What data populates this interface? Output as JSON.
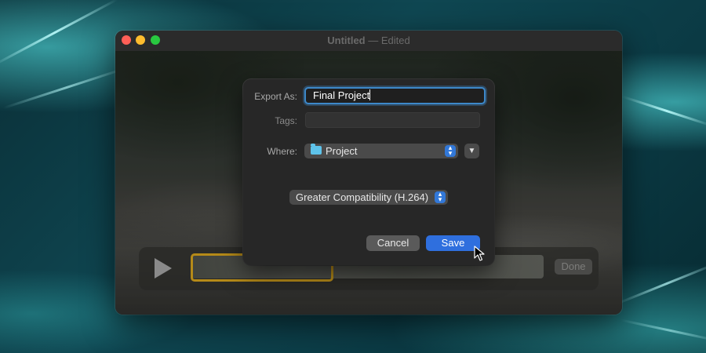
{
  "window": {
    "title": "Untitled",
    "separator": "—",
    "status": "Edited"
  },
  "trim_bar": {
    "done_label": "Done"
  },
  "export_sheet": {
    "export_as_label": "Export As:",
    "export_as_value": "Final Project",
    "tags_label": "Tags:",
    "tags_value": "",
    "where_label": "Where:",
    "where_value": "Project",
    "format_value": "Greater Compatibility (H.264)",
    "cancel_label": "Cancel",
    "save_label": "Save"
  },
  "icons": {
    "folder": "folder-icon",
    "stepper": "up-down-chevron-icon",
    "expand": "chevron-down-icon",
    "play": "play-icon",
    "cursor": "mouse-pointer-icon"
  },
  "colors": {
    "accent": "#3278d8",
    "save_button": "#2f6fde",
    "focus_ring": "#3d88c9",
    "trim_handle": "#b58a18",
    "folder": "#5ec3ea"
  }
}
